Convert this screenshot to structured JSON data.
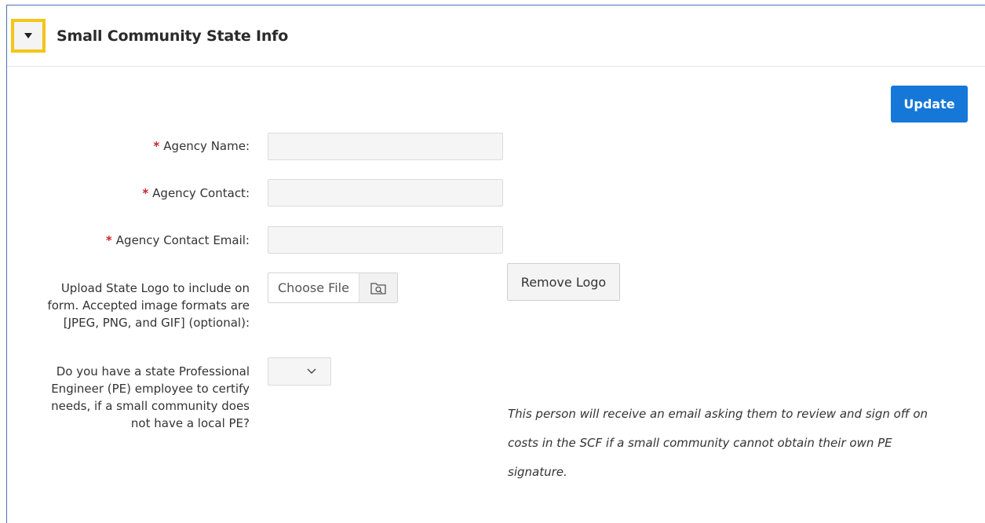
{
  "region": {
    "title": "Small Community State Info",
    "collapse_icon": "caret-down-icon"
  },
  "toolbar": {
    "update_label": "Update"
  },
  "form": {
    "required_marker": "*",
    "agency_name_label": "Agency Name:",
    "agency_name_value": "",
    "agency_contact_label": "Agency Contact:",
    "agency_contact_value": "",
    "agency_contact_email_label": "Agency Contact Email:",
    "agency_contact_email_value": "",
    "logo_label_lines": [
      "Upload State Logo to include on",
      "form. Accepted image formats are",
      "[JPEG, PNG, and GIF] (optional):"
    ],
    "file_chooser_label": "Choose File",
    "file_chooser_icon": "folder-search-icon",
    "remove_logo_label": "Remove Logo",
    "pe_question_lines": [
      "Do you have a state Professional",
      "Engineer (PE) employee to certify",
      "needs, if a small community does",
      "not have a local PE?"
    ],
    "pe_select_value": "",
    "pe_select_icon": "chevron-down-icon",
    "pe_note_lines": [
      "This person will receive an email asking them to review and sign off on",
      "costs in the SCF if a small community cannot obtain their own PE",
      "signature."
    ]
  },
  "colors": {
    "accent": "#1578d8",
    "focus_outline": "#f5c518",
    "required": "#d0202b",
    "frame_border": "#4a6fb5"
  }
}
